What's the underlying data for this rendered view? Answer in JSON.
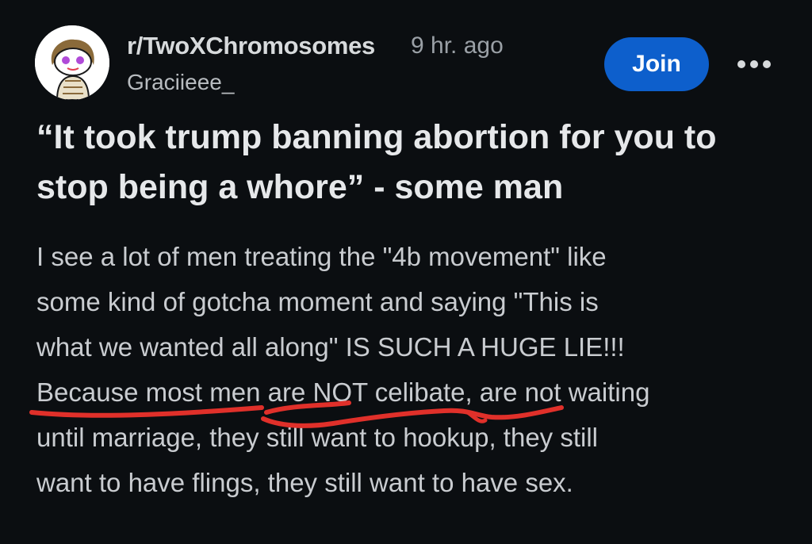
{
  "post": {
    "subreddit": "r/TwoXChromosomes",
    "time": "9 hr. ago",
    "author": "Graciieee_",
    "join_label": "Join",
    "more_icon": "more-horizontal-icon",
    "avatar_icon": "reddit-avatar-icon",
    "title": "“It took trump banning abortion for you to stop being a whore” - some man",
    "body_lines": [
      "I see a lot of men treating the \"4b movement\" like",
      "some kind of gotcha moment and saying \"This is",
      "what we wanted all along\" IS SUCH A HUGE LIE!!!",
      "Because most men are NOT celibate, are not waiting",
      "until marriage, they still want to hookup, they still",
      "want to have flings, they still want to have sex."
    ]
  },
  "colors": {
    "background": "#0b0e11",
    "join_button": "#0d5fcc",
    "underline_annotation": "#e0302a"
  }
}
